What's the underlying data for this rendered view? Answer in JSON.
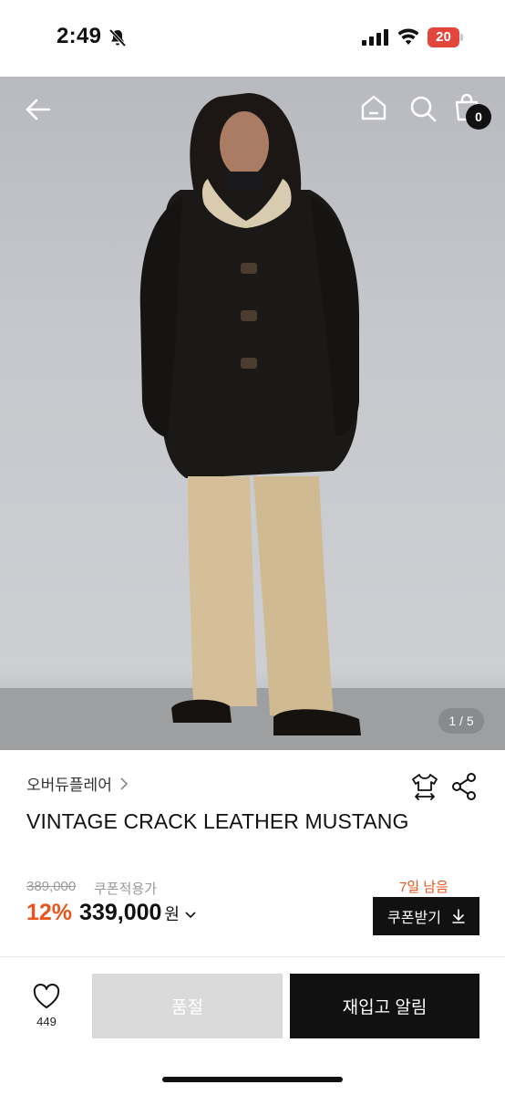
{
  "status_bar": {
    "time": "2:49",
    "battery": "20",
    "icons": [
      "bell-slash-icon",
      "signal-icon",
      "wifi-icon",
      "battery-icon"
    ]
  },
  "top_nav": {
    "icons": [
      "back-arrow-icon",
      "home-icon",
      "search-icon",
      "shopping-bag-icon"
    ],
    "cart_count": "0"
  },
  "gallery": {
    "page_indicator": "1 / 5"
  },
  "product": {
    "brand": "오버듀플레어",
    "title": "VINTAGE CRACK LEATHER MUSTANG",
    "icons": [
      "size-guide-icon",
      "share-icon"
    ]
  },
  "pricing": {
    "original_price": "389,000",
    "coupon_label": "쿠폰적용가",
    "discount": "12%",
    "price": "339,000",
    "currency": "원",
    "days_left": "7일 남음",
    "coupon_button": "쿠폰받기"
  },
  "bottom_bar": {
    "like_count": "449",
    "soldout_label": "품절",
    "restock_label": "재입고 알림"
  },
  "colors": {
    "accent": "#e8541e",
    "primary": "#111111",
    "disabled": "#dadada"
  }
}
